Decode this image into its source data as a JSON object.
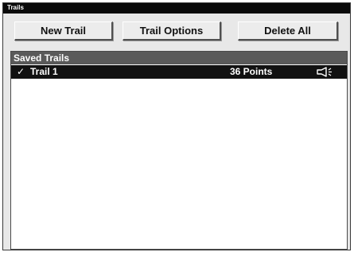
{
  "window": {
    "title": "Trails"
  },
  "toolbar": {
    "new_trail_label": "New Trail",
    "trail_options_label": "Trail Options",
    "delete_all_label": "Delete All"
  },
  "list": {
    "header": "Saved Trails",
    "items": [
      {
        "checked": true,
        "check_mark": "✓",
        "name": "Trail 1",
        "points": "36 Points",
        "icon": "speaker-icon"
      }
    ]
  },
  "colors": {
    "titlebar": "#0a0a0a",
    "list_header": "#5a5a5a",
    "selected_row": "#111111",
    "window_bg": "#e8e8e8"
  }
}
